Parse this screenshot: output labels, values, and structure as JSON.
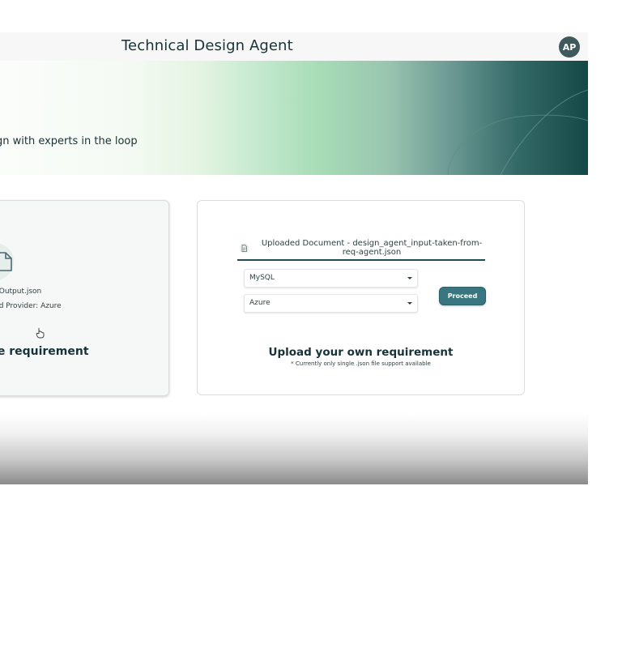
{
  "header": {
    "title": "Technical Design Agent",
    "avatar_initials": "AP"
  },
  "hero": {
    "tagline": "gn with experts in the loop"
  },
  "sample_card": {
    "file_name": "nt_Output.json",
    "cloud_provider": "loud Provider: Azure",
    "heading": "ple requirement",
    "icon": "document-icon"
  },
  "upload_card": {
    "uploaded_document": "Uploaded Document - design_agent_input-taken-from-req-agent.json",
    "database_select": {
      "value": "MySQL"
    },
    "cloud_select": {
      "value": "Azure"
    },
    "proceed_label": "Proceed",
    "heading": "Upload your own requirement",
    "note": "* Currently only single .json file support available"
  },
  "colors": {
    "accent": "#3a7680",
    "text": "#173238",
    "hero_dark": "#154947",
    "hero_light": "#a5dbb5"
  }
}
